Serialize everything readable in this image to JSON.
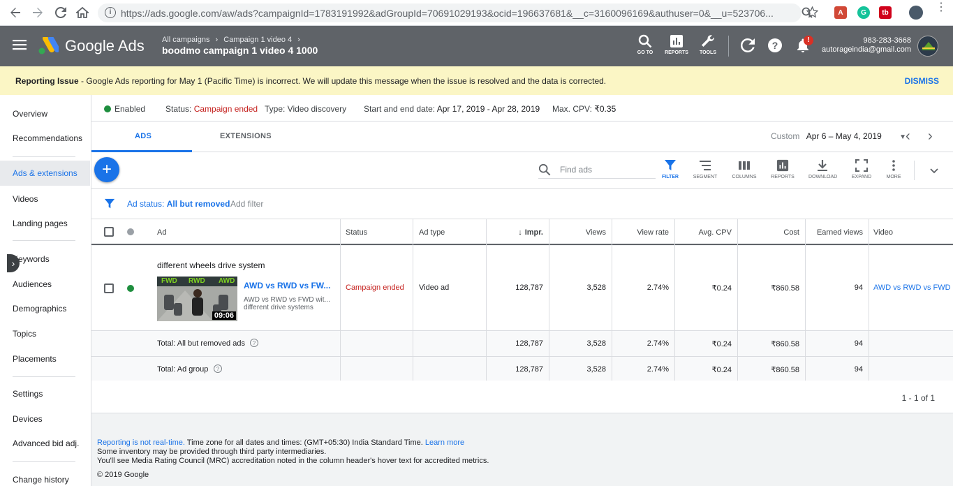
{
  "browser": {
    "url": "https://ads.google.com/aw/ads?campaignId=1783191992&adGroupId=70691029193&ocid=196637681&__c=3160096169&authuser=0&__u=523706..."
  },
  "header": {
    "logo": "Google Ads",
    "breadcrumb_1": "All campaigns",
    "breadcrumb_2": "Campaign 1 video 4",
    "title": "boodmo campaign 1 video 4 1000",
    "tools": {
      "goto": "GO TO",
      "reports": "REPORTS",
      "tools": "TOOLS"
    },
    "notification_badge": "!",
    "phone": "983-283-3668",
    "email": "autorageindia@gmail.com"
  },
  "banner": {
    "bold": "Reporting Issue",
    "message": " - Google Ads reporting for May 1 (Pacific Time) is incorrect. We will update this message when the issue is resolved and the data is corrected.",
    "dismiss": "DISMISS"
  },
  "sidebar": {
    "items": [
      "Overview",
      "Recommendations",
      "Ads & extensions",
      "Videos",
      "Landing pages",
      "Keywords",
      "Audiences",
      "Demographics",
      "Topics",
      "Placements",
      "Settings",
      "Devices",
      "Advanced bid adj.",
      "Change history"
    ]
  },
  "summary": {
    "enabled": "Enabled",
    "status_label": "Status:",
    "status_value": "Campaign ended",
    "type": "Type: Video discovery",
    "dates_label": "Start and end date:",
    "dates_value": "Apr 17, 2019 - Apr 28, 2019",
    "cpv_label": "Max. CPV:",
    "cpv_value": "₹0.35"
  },
  "tabs": {
    "ads": "ADS",
    "extensions": "EXTENSIONS"
  },
  "date_range": {
    "label": "Custom",
    "value": "Apr 6 – May 4, 2019"
  },
  "toolbar": {
    "search_placeholder": "Find ads",
    "filter": "FILTER",
    "segment": "SEGMENT",
    "columns": "COLUMNS",
    "reports": "REPORTS",
    "download": "DOWNLOAD",
    "expand": "EXPAND",
    "more": "MORE"
  },
  "filter": {
    "label": "Ad status:",
    "value": "All but removed",
    "add": "Add filter"
  },
  "table": {
    "headers": {
      "ad": "Ad",
      "status": "Status",
      "ad_type": "Ad type",
      "impr": "Impr.",
      "views": "Views",
      "view_rate": "View rate",
      "avg_cpv": "Avg. CPV",
      "cost": "Cost",
      "earned_views": "Earned views",
      "video": "Video"
    },
    "ad_row": {
      "group_name": "different wheels drive system",
      "headline": "AWD vs RWD vs FW...",
      "description_1": "AWD vs RWD vs FWD wit...",
      "description_2": "different drive systems",
      "thumb_label_1": "FWD",
      "thumb_label_2": "RWD",
      "thumb_label_3": "AWD",
      "duration": "09:06",
      "status": "Campaign ended",
      "ad_type": "Video ad",
      "impr": "128,787",
      "views": "3,528",
      "view_rate": "2.74%",
      "avg_cpv": "₹0.24",
      "cost": "₹860.58",
      "earned_views": "94",
      "video": "AWD vs RWD vs FWD E"
    },
    "totals": [
      {
        "label": "Total: All but removed ads",
        "impr": "128,787",
        "views": "3,528",
        "view_rate": "2.74%",
        "avg_cpv": "₹0.24",
        "cost": "₹860.58",
        "earned_views": "94"
      },
      {
        "label": "Total: Ad group",
        "impr": "128,787",
        "views": "3,528",
        "view_rate": "2.74%",
        "avg_cpv": "₹0.24",
        "cost": "₹860.58",
        "earned_views": "94"
      }
    ],
    "pagination": "1 - 1 of 1"
  },
  "footer": {
    "realtime_link": "Reporting is not real-time.",
    "timezone": " Time zone for all dates and times: (GMT+05:30) India Standard Time. ",
    "learn_more": "Learn more",
    "line2": "Some inventory may be provided through third party intermediaries.",
    "line3": "You'll see Media Rating Council (MRC) accreditation noted in the column header's hover text for accredited metrics.",
    "copyright": "© 2019 Google"
  },
  "colors": {
    "accent": "#1a73e8",
    "header_bg": "#5f6368",
    "banner_bg": "#fbf6c5",
    "ended_red": "#c5221f",
    "enabled_green": "#1e8e3e"
  }
}
